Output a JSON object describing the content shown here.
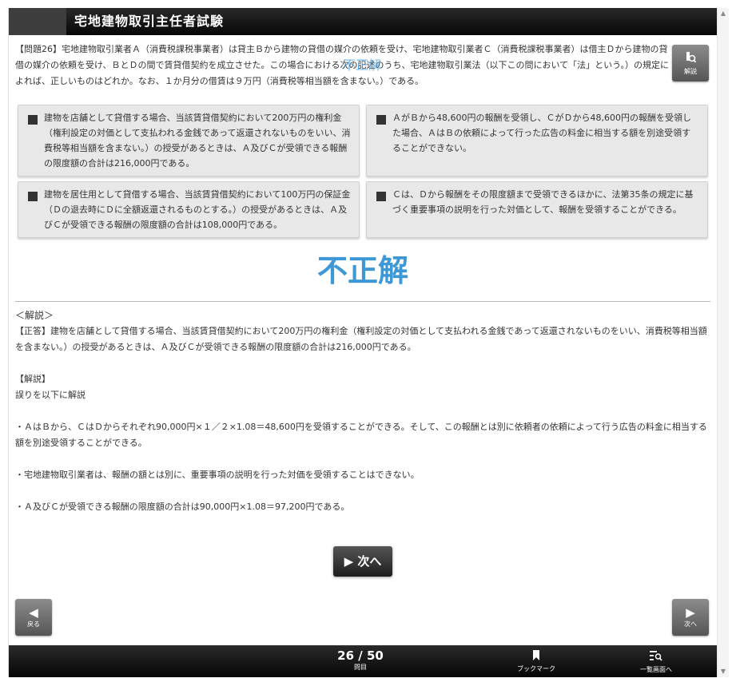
{
  "header": {
    "title": "宅地建物取引主任者試験"
  },
  "question": {
    "text": "【問題26】宅地建物取引業者Ａ（消費税課税事業者）は貸主Ｂから建物の貸借の媒介の依頼を受け、宅地建物取引業者Ｃ（消費税課税事業者）は借主Ｄから建物の貸借の媒介の依頼を受け、ＢとＤの間で賃貸借契約を成立させた。この場合における次の記述のうち、宅地建物取引業法（以下この問において「法」という。）の規定によれば、正しいものはどれか。なお、１か月分の借賃は９万円（消費税等相当額を含まない。）である。",
    "ghost_verdict": "不正解"
  },
  "kaisetsu_button": {
    "label": "解説",
    "icon": "lightbulb-icon"
  },
  "choices": [
    {
      "text": "建物を店舗として貸借する場合、当該賃貸借契約において200万円の権利金（権利設定の対価として支払われる金銭であって返還されないものをいい、消費税等相当額を含まない。）の授受があるときは、Ａ及びＣが受領できる報酬の限度額の合計は216,000円である。"
    },
    {
      "text": "ＡがＢから48,600円の報酬を受領し、ＣがＤから48,600円の報酬を受領した場合、ＡはＢの依頼によって行った広告の料金に相当する額を別途受領することができない。"
    },
    {
      "text": "建物を居住用として貸借する場合、当該賃貸借契約において100万円の保証金（Ｄの退去時にＤに全額返還されるものとする。）の授受があるときは、Ａ及びＣが受領できる報酬の限度額の合計は108,000円である。"
    },
    {
      "text": "Ｃは、Ｄから報酬をその限度額まで受領できるほかに、法第35条の規定に基づく重要事項の説明を行った対価として、報酬を受領することができる。"
    }
  ],
  "verdict": "不正解",
  "explanation": {
    "heading": "＜解説＞",
    "answer": "【正答】建物を店舗として貸借する場合、当該賃貸借契約において200万円の権利金（権利設定の対価として支払われる金銭であって返還されないものをいい、消費税等相当額を含まない。）の授受があるときは、Ａ及びＣが受領できる報酬の限度額の合計は216,000円である。",
    "subheading": "【解説】",
    "intro": "誤りを以下に解説",
    "points": [
      "・ＡはＢから、ＣはＤからそれぞれ90,000円×１／２×1.08＝48,600円を受領することができる。そして、この報酬とは別に依頼者の依頼によって行う広告の料金に相当する額を別途受領することができる。",
      "・宅地建物取引業者は、報酬の額とは別に、重要事項の説明を行った対価を受領することはできない。",
      "・Ａ及びＣが受領できる報酬の限度額の合計は90,000円×1.08＝97,200円である。"
    ]
  },
  "next_center": {
    "label": "▶ 次へ"
  },
  "nav": {
    "prev": {
      "label": "戻る",
      "icon": "◀"
    },
    "next": {
      "label": "次へ",
      "icon": "▶"
    }
  },
  "footer": {
    "counter": "26 / 50",
    "counter_label": "問目",
    "bookmark_label": "ブックマーク",
    "list_label": "一覧画面へ"
  }
}
